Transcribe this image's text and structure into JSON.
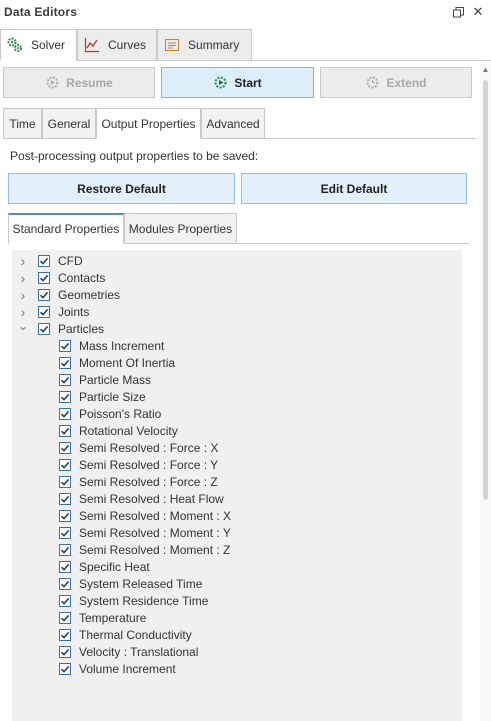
{
  "panel": {
    "title": "Data Editors"
  },
  "main_tabs": [
    {
      "label": "Solver"
    },
    {
      "label": "Curves"
    },
    {
      "label": "Summary"
    }
  ],
  "run_buttons": {
    "resume": "Resume",
    "start": "Start",
    "extend": "Extend"
  },
  "sub_tabs": [
    {
      "label": "Time"
    },
    {
      "label": "General"
    },
    {
      "label": "Output Properties"
    },
    {
      "label": "Advanced"
    }
  ],
  "description": "Post-processing output properties to be saved:",
  "actions": {
    "restore": "Restore Default",
    "edit": "Edit Default"
  },
  "prop_tabs": [
    {
      "label": "Standard Properties"
    },
    {
      "label": "Modules Properties"
    }
  ],
  "tree": {
    "groups": [
      {
        "label": "CFD",
        "expanded": false,
        "checked": true
      },
      {
        "label": "Contacts",
        "expanded": false,
        "checked": true
      },
      {
        "label": "Geometries",
        "expanded": false,
        "checked": true
      },
      {
        "label": "Joints",
        "expanded": false,
        "checked": true
      },
      {
        "label": "Particles",
        "expanded": true,
        "checked": true
      }
    ],
    "particle_items": [
      "Mass Increment",
      "Moment Of Inertia",
      "Particle Mass",
      "Particle Size",
      "Poisson's Ratio",
      "Rotational Velocity",
      "Semi Resolved : Force : X",
      "Semi Resolved : Force : Y",
      "Semi Resolved : Force : Z",
      "Semi Resolved : Heat Flow",
      "Semi Resolved : Moment : X",
      "Semi Resolved : Moment : Y",
      "Semi Resolved : Moment : Z",
      "Specific Heat",
      "System Released Time",
      "System Residence Time",
      "Temperature",
      "Thermal Conductivity",
      "Velocity : Translational",
      "Volume Increment"
    ]
  },
  "colors": {
    "accent": "#4a90d0",
    "checkbox_border": "#3d6fa8",
    "primary_button_bg": "#dbeefa",
    "tree_bg": "#f0f0f0"
  }
}
